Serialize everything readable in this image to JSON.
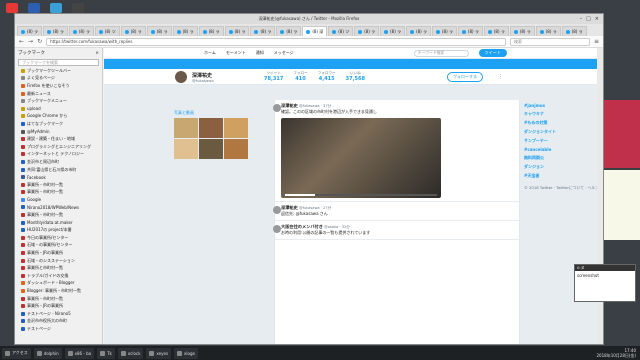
{
  "window": {
    "title": "深澤祐史(@fukasawa) さん / Twitter - Mozilla Firefox"
  },
  "tabs": [
    "(8) ラ",
    "(8) ラ",
    "(8) ラ",
    "(8) ツ",
    "(8) ラ",
    "(8) ラ",
    "(8) ラ",
    "(8) ラ",
    "(8) ラ",
    "(8) ラ",
    "(8) ラ",
    "(8) 深",
    "(8) ツ",
    "(8) ラ",
    "(8) ラ",
    "(8) ラ",
    "(8) ラ",
    "(8) ラ",
    "(8) ラ",
    "(8) ラ",
    "(8) ラ",
    "(8) ラ"
  ],
  "url": "https://twitter.com/fukasawa/with_replies",
  "search_placeholder": "検索",
  "sidebar": {
    "title": "ブックマーク",
    "search": "ブックマークを検索",
    "items": [
      {
        "label": "ブックマークツールバー",
        "color": "#c8a000"
      },
      {
        "label": "よく見るページ",
        "color": "#888"
      },
      {
        "label": "Firefox を使いこなそう",
        "color": "#e06020"
      },
      {
        "label": "最新ニュース",
        "color": "#e06020"
      },
      {
        "label": "ブックマークメニュー",
        "color": "#888"
      },
      {
        "label": "upload",
        "color": "#c8a000"
      },
      {
        "label": "Google Chrome から",
        "color": "#c8a000"
      },
      {
        "label": "はてなブックマーク",
        "color": "#1e5fd0"
      },
      {
        "label": "@MyAdmin",
        "color": "#555"
      },
      {
        "label": "建設・建築・住まい・地域",
        "color": "#c03030"
      },
      {
        "label": "プログラミングとエンジニアリング",
        "color": "#c03030"
      },
      {
        "label": "インターネットと テクノロジー",
        "color": "#c03030"
      },
      {
        "label": "金沢市と周辺市町",
        "color": "#2060c0"
      },
      {
        "label": "共同:富山県と石川県の市町",
        "color": "#2060c0"
      },
      {
        "label": "Facebook",
        "color": "#3b5998"
      },
      {
        "label": "事業所・市町村一覧",
        "color": "#c03030"
      },
      {
        "label": "事業所・市町村一覧",
        "color": "#c03030"
      },
      {
        "label": "Google",
        "color": "#4285f4"
      },
      {
        "label": "Nirano2018/WPWeb/News",
        "color": "#2060c0"
      },
      {
        "label": "事業所・市町村一覧",
        "color": "#c03030"
      },
      {
        "label": "Monthly/data:at.maker",
        "color": "#2060c0"
      },
      {
        "label": "HU2017の project/本番",
        "color": "#2060c0"
      },
      {
        "label": "今日の事業所/センター",
        "color": "#c03030"
      },
      {
        "label": "石域・の事業所/センター",
        "color": "#c03030"
      },
      {
        "label": "事業所・JRの事業所",
        "color": "#c03030"
      },
      {
        "label": "石域・のシスステーション",
        "color": "#c03030"
      },
      {
        "label": "事業所と市町村一覧",
        "color": "#c03030"
      },
      {
        "label": "トラブル/ガイドの交換",
        "color": "#c03030"
      },
      {
        "label": "ダッシュボード・Blogger",
        "color": "#e06020"
      },
      {
        "label": "Blogger: 事業所・市町村一覧",
        "color": "#e06020"
      },
      {
        "label": "事業所・市町村一覧",
        "color": "#c03030"
      },
      {
        "label": "事業所・JRの事業所",
        "color": "#c03030"
      },
      {
        "label": "テストページ - Nirano5",
        "color": "#2060c0"
      },
      {
        "label": "金沢市市役所大の市町",
        "color": "#2060c0"
      },
      {
        "label": "テストページ",
        "color": "#2060c0"
      }
    ]
  },
  "twitter": {
    "nav": [
      "ホーム",
      "モーメント",
      "通知",
      "メッセージ"
    ],
    "search": "キーワード検索",
    "tweet_btn": "ツイート",
    "profile": {
      "name": "深澤祐史",
      "handle": "@fukasawa",
      "stats": [
        {
          "label": "ツイート",
          "value": "78,317"
        },
        {
          "label": "フォロー",
          "value": "410"
        },
        {
          "label": "フォロワー",
          "value": "4,415"
        },
        {
          "label": "いいね",
          "value": "37,568"
        }
      ],
      "follow": "フォローする"
    },
    "photos_label": "写真と動画",
    "tweets": [
      {
        "user": "深澤祐史",
        "meta": "@fukasawa · 37分",
        "text": "確認。このの区域の市町村を港辺が入手できる見通し"
      },
      {
        "user": "深澤祐史",
        "meta": "@fukasawa · 27分",
        "text": "返信先: @fukasawa さん"
      },
      {
        "user": "大阪在住のメンバ付き",
        "meta": "@osaka · 32分",
        "text": "お時の利用:公開の記事の一覧も提供されています"
      }
    ],
    "trends": [
      "#janjmus",
      "キャウキナ",
      "#もめの対策",
      "ダンジョンタイト",
      "サンプーテー",
      "#cancelable",
      "無料同期公",
      "ダンジョン",
      "#天宝者"
    ],
    "footer": "© 2018 Twitter · Twitterについて · ヘルプセンター"
  },
  "term": {
    "title": "0:ヌ",
    "line": "screenshot"
  },
  "taskbar": {
    "items": [
      "アクセス",
      "dolphin",
      "x86 - ba",
      "Tk",
      "xclock",
      "xeyes",
      "xlogo"
    ],
    "time": "17:40",
    "date": "2018年10月28日(金)"
  }
}
